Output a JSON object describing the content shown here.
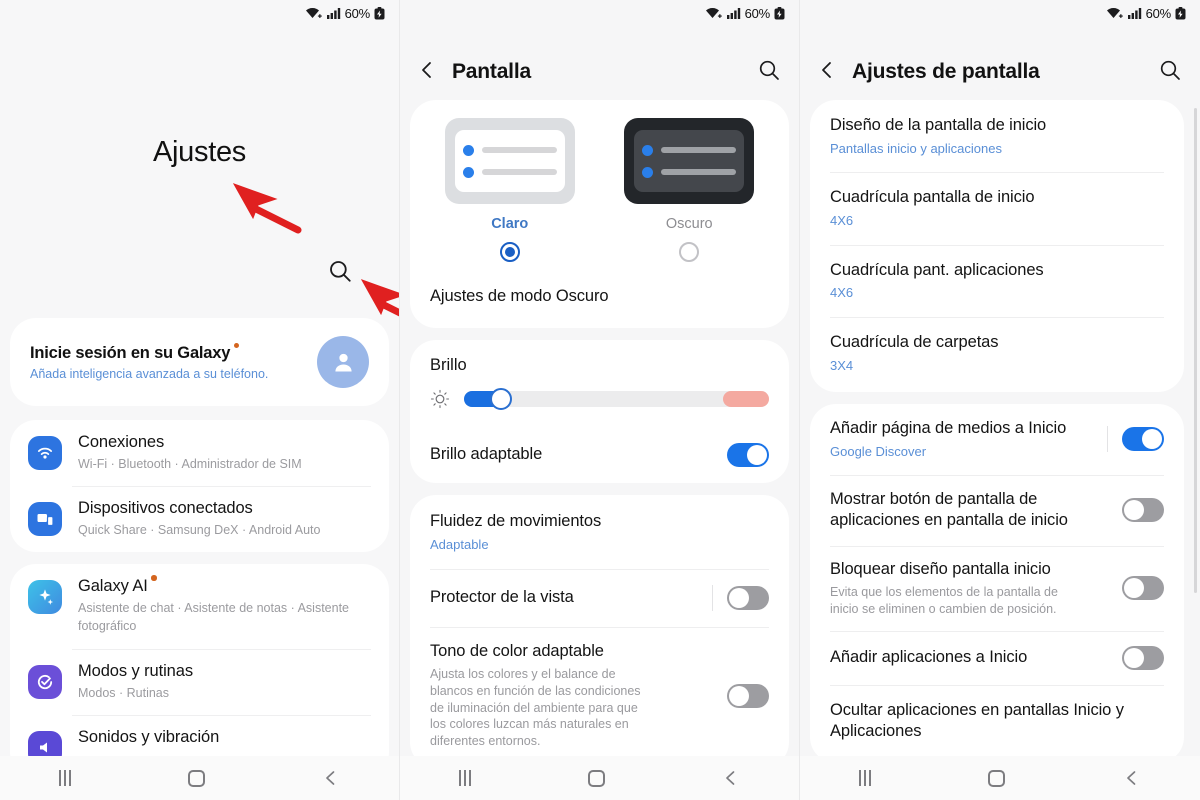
{
  "status_bar": {
    "battery_percent": "60%",
    "wifi_icon": "wifi-plus-icon",
    "signal_icon": "cellular-signal-icon",
    "battery_icon": "battery-icon"
  },
  "panel1": {
    "title": "Ajustes",
    "search_icon": "search-icon",
    "account": {
      "title": "Inicie sesión en su Galaxy",
      "subtitle": "Añada inteligencia avanzada a su teléfono.",
      "avatar_icon": "person-avatar-icon",
      "badge_color": "#d4651f"
    },
    "group1": [
      {
        "title": "Conexiones",
        "subtitle": "Wi-Fi  ·  Bluetooth  ·  Administrador de SIM",
        "icon": "wifi-icon",
        "color": "#2d74e0"
      },
      {
        "title": "Dispositivos conectados",
        "subtitle": "Quick Share  ·  Samsung DeX  ·  Android Auto",
        "icon": "connected-devices-icon",
        "color": "#2d74e0"
      }
    ],
    "group2": [
      {
        "title": "Galaxy AI",
        "subtitle": "Asistente de chat  ·  Asistente de notas  ·  Asistente fotográfico",
        "icon": "galaxy-ai-sparkle-icon",
        "color": "#3f8ae0",
        "badge": true
      },
      {
        "title": "Modos y rutinas",
        "subtitle": "Modos  ·  Rutinas",
        "icon": "modes-routines-icon",
        "color": "#6b4fd8"
      },
      {
        "title": "Sonidos y vibración",
        "subtitle": "",
        "icon": "sound-vibration-icon",
        "color": "#5a49d6"
      }
    ]
  },
  "panel2": {
    "header": {
      "title": "Pantalla",
      "back_icon": "chevron-left-icon",
      "search_icon": "search-icon"
    },
    "theme": {
      "light_label": "Claro",
      "dark_label": "Oscuro",
      "selected": "Claro",
      "dark_mode_settings": "Ajustes de modo Oscuro"
    },
    "brightness": {
      "label": "Brillo",
      "icon": "brightness-sun-icon",
      "value_percent": 12,
      "warm_start_percent": 85,
      "adaptive_label": "Brillo adaptable",
      "adaptive_on": true
    },
    "rows": [
      {
        "title": "Fluidez de movimientos",
        "subtitle": "Adaptable",
        "subtitle_style": "blue"
      },
      {
        "title": "Protector de la vista",
        "subtitle": "",
        "toggle": "off",
        "divider": true
      },
      {
        "title": "Tono de color adaptable",
        "subtitle": "Ajusta los colores y el balance de blancos en función de las condiciones de iluminación del ambiente para que los colores luzcan más naturales en diferentes entornos.",
        "toggle": "off"
      }
    ]
  },
  "panel3": {
    "header": {
      "title": "Ajustes de pantalla",
      "back_icon": "chevron-left-icon",
      "search_icon": "search-icon"
    },
    "group1": [
      {
        "title": "Diseño de la pantalla de inicio",
        "subtitle": "Pantallas inicio y aplicaciones"
      },
      {
        "title": "Cuadrícula pantalla de inicio",
        "subtitle": "4X6"
      },
      {
        "title": "Cuadrícula pant. aplicaciones",
        "subtitle": "4X6"
      },
      {
        "title": "Cuadrícula de carpetas",
        "subtitle": "3X4"
      }
    ],
    "group2": [
      {
        "title": "Añadir página de medios a Inicio",
        "subtitle": "Google Discover",
        "toggle": "on",
        "divider": true
      },
      {
        "title": "Mostrar botón de pantalla de aplicaciones en pantalla de inicio",
        "subtitle": "",
        "toggle": "off"
      },
      {
        "title": "Bloquear diseño pantalla inicio",
        "subtitle": "Evita que los elementos de la pantalla de inicio se eliminen o cambien de posición.",
        "toggle": "off"
      },
      {
        "title": "Añadir aplicaciones a Inicio",
        "subtitle": "",
        "toggle": "off"
      },
      {
        "title": "Ocultar aplicaciones en pantallas Inicio y Aplicaciones",
        "subtitle": ""
      }
    ]
  },
  "navbar": {
    "recents_icon": "recents-icon",
    "home_icon": "home-icon",
    "back_icon": "back-chevron-icon"
  },
  "annotations": {
    "arrow_color": "#e02020",
    "count": 4
  }
}
